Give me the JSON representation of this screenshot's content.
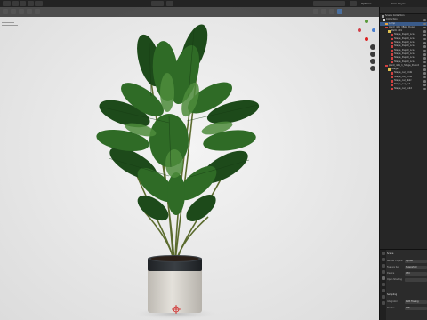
{
  "topbar": {
    "layout_menu": "Options",
    "view_layer": "View Layer"
  },
  "viewport": {
    "shading_mode": "Object"
  },
  "outliner": {
    "title": "Scene Collection",
    "rows": [
      {
        "label": "Collection",
        "kind": "collection",
        "indent": 1,
        "selected": false
      },
      {
        "label": "Lamp",
        "kind": "object",
        "indent": 2,
        "selected": true
      },
      {
        "label": "plant_n01_3Bgp_Dupot",
        "kind": "mesh",
        "indent": 2,
        "selected": false
      },
      {
        "label": "Palm n01",
        "kind": "empty",
        "indent": 3,
        "selected": false
      },
      {
        "label": "Stage_Dupot_Lca",
        "kind": "mesh",
        "indent": 4,
        "selected": false
      },
      {
        "label": "Stage_Dupot_Lca",
        "kind": "mesh",
        "indent": 4,
        "selected": false
      },
      {
        "label": "Stage_Dupot_Lca",
        "kind": "mesh",
        "indent": 4,
        "selected": false
      },
      {
        "label": "Stage_Dupot_Lca",
        "kind": "mesh",
        "indent": 4,
        "selected": false
      },
      {
        "label": "Stage_Dupot_Lca",
        "kind": "mesh",
        "indent": 4,
        "selected": false
      },
      {
        "label": "Stage_Dupot_Lca",
        "kind": "mesh",
        "indent": 4,
        "selected": false
      },
      {
        "label": "Stage_Dupot_Lca",
        "kind": "mesh",
        "indent": 4,
        "selected": false
      },
      {
        "label": "Stage_Dupot_Lca",
        "kind": "mesh",
        "indent": 4,
        "selected": false
      },
      {
        "label": "plant_n01_1_Stage_Dupot",
        "kind": "mesh",
        "indent": 2,
        "selected": false
      },
      {
        "label": "Stage",
        "kind": "empty",
        "indent": 3,
        "selected": false
      },
      {
        "label": "Stage_cel_cmbl",
        "kind": "mesh",
        "indent": 4,
        "selected": false
      },
      {
        "label": "Stage_cel_cmbl",
        "kind": "mesh",
        "indent": 4,
        "selected": false
      },
      {
        "label": "Stage_cel_distr",
        "kind": "mesh",
        "indent": 4,
        "selected": false
      },
      {
        "label": "Stage_cel_soil",
        "kind": "mesh",
        "indent": 4,
        "selected": false
      },
      {
        "label": "Stage_cel_soild",
        "kind": "mesh",
        "indent": 4,
        "selected": false
      }
    ]
  },
  "properties": {
    "section": "Scene",
    "rows": [
      {
        "label": "Render Engine",
        "value": "Cycles"
      },
      {
        "label": "Feature Set",
        "value": "Supported"
      },
      {
        "label": "Device",
        "value": "CPU"
      },
      {
        "label": "Open Shading",
        "value": ""
      }
    ],
    "subsection": "Sampling",
    "sub_rows": [
      {
        "label": "Integrator",
        "value": "Path Tracing"
      },
      {
        "label": "Render",
        "value": "128"
      }
    ]
  },
  "colors": {
    "leaf_dark": "#1d4a1a",
    "leaf_mid": "#2f6b26",
    "leaf_light": "#4e8c3c",
    "pot_rim": "#2e3236",
    "pot_body": "#d9d6d0",
    "accent_select": "#3a5b8a"
  }
}
